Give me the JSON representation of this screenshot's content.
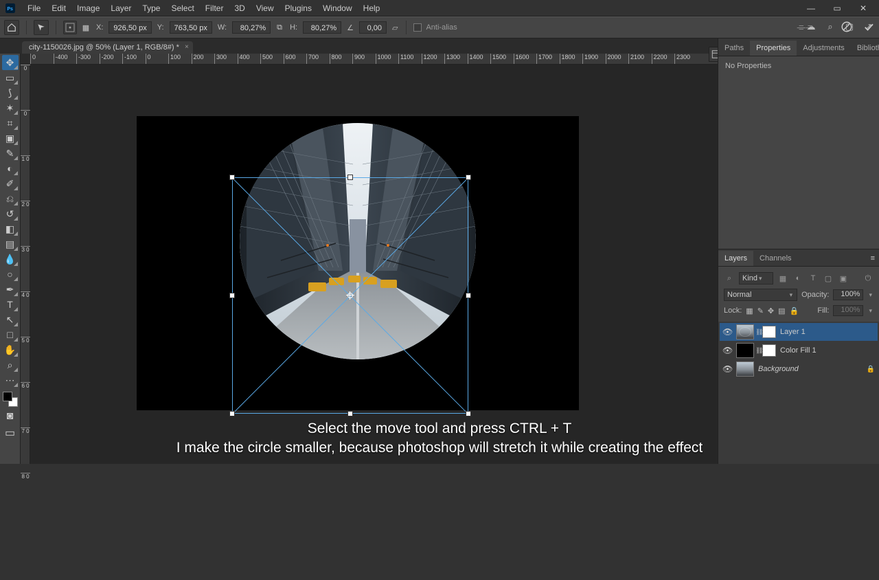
{
  "menu": {
    "items": [
      "File",
      "Edit",
      "Image",
      "Layer",
      "Type",
      "Select",
      "Filter",
      "3D",
      "View",
      "Plugins",
      "Window",
      "Help"
    ]
  },
  "options_bar": {
    "x_label": "X:",
    "x_value": "926,50 px",
    "y_label": "Y:",
    "y_value": "763,50 px",
    "w_label": "W:",
    "w_value": "80,27%",
    "h_label": "H:",
    "h_value": "80,27%",
    "angle_value": "0,00",
    "skew_value": "",
    "antialias": "Anti-alias"
  },
  "document_tab": {
    "title": "city-1150026.jpg @ 50% (Layer 1, RGB/8#) *"
  },
  "ruler_h": [
    "0",
    "-400",
    "-300",
    "-200",
    "-100",
    "0",
    "100",
    "200",
    "300",
    "400",
    "500",
    "600",
    "700",
    "800",
    "900",
    "1000",
    "1100",
    "1200",
    "1300",
    "1400",
    "1500",
    "1600",
    "1700",
    "1800",
    "1900",
    "2000",
    "2100",
    "2200",
    "2300"
  ],
  "ruler_v": [
    "0",
    "0",
    "1 0",
    "2 0",
    "3 0",
    "4 0",
    "5 0",
    "6 0",
    "7 0",
    "8 0"
  ],
  "caption_line1": "Select the move tool and press CTRL + T",
  "caption_line2": "I make the circle smaller, because photoshop will stretch it while creating the effect",
  "panels": {
    "top_tabs": [
      "Paths",
      "Properties",
      "Adjustments",
      "Bibliotheken"
    ],
    "top_active": 1,
    "no_props": "No Properties",
    "mid_tabs": [
      "Layers",
      "Channels"
    ],
    "mid_active": 0
  },
  "layers_panel": {
    "filter_label": "Kind",
    "blend_mode": "Normal",
    "opacity_label": "Opacity:",
    "opacity_value": "100%",
    "lock_label": "Lock:",
    "fill_label": "Fill:",
    "fill_value": "100%",
    "layers": [
      {
        "name": "Layer 1",
        "visible": true,
        "selected": true,
        "thumb_type": "city_circle",
        "has_mask": true
      },
      {
        "name": "Color Fill 1",
        "visible": true,
        "selected": false,
        "thumb_type": "black",
        "has_mask": true
      },
      {
        "name": "Background",
        "visible": true,
        "selected": false,
        "thumb_type": "city",
        "italic": true,
        "locked": true
      }
    ]
  },
  "tools": [
    {
      "id": "move-tool",
      "glyph": "✥",
      "active": true
    },
    {
      "id": "marquee-tool",
      "glyph": "▭"
    },
    {
      "id": "lasso-tool",
      "glyph": "⟆"
    },
    {
      "id": "magic-wand-tool",
      "glyph": "✶"
    },
    {
      "id": "crop-tool",
      "glyph": "⌗"
    },
    {
      "id": "frame-tool",
      "glyph": "▣"
    },
    {
      "id": "eyedropper-tool",
      "glyph": "✎"
    },
    {
      "id": "spot-heal-tool",
      "glyph": "◐"
    },
    {
      "id": "brush-tool",
      "glyph": "✐"
    },
    {
      "id": "clone-stamp-tool",
      "glyph": "⎌"
    },
    {
      "id": "history-brush-tool",
      "glyph": "↺"
    },
    {
      "id": "eraser-tool",
      "glyph": "◧"
    },
    {
      "id": "gradient-tool",
      "glyph": "▤"
    },
    {
      "id": "blur-tool",
      "glyph": "💧"
    },
    {
      "id": "dodge-tool",
      "glyph": "○"
    },
    {
      "id": "pen-tool",
      "glyph": "✒"
    },
    {
      "id": "type-tool",
      "glyph": "T"
    },
    {
      "id": "path-select-tool",
      "glyph": "↖"
    },
    {
      "id": "shape-tool",
      "glyph": "□"
    },
    {
      "id": "hand-tool",
      "glyph": "✋"
    },
    {
      "id": "zoom-tool",
      "glyph": "⌕"
    },
    {
      "id": "more-tools",
      "glyph": "⋯"
    }
  ]
}
